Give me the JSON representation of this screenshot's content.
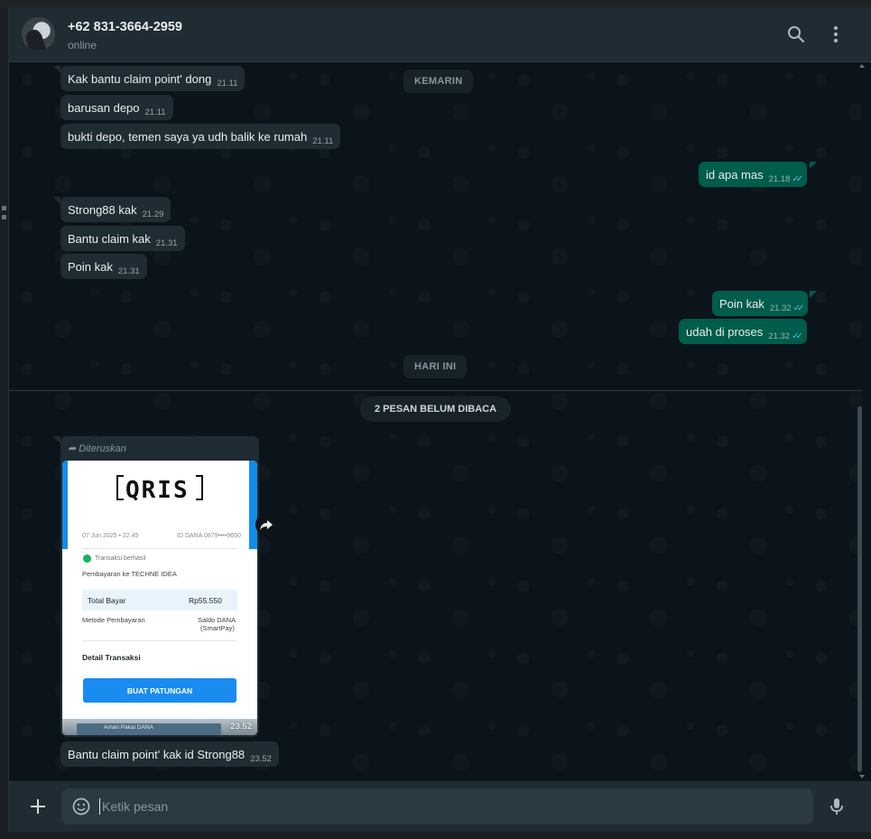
{
  "header": {
    "contact_name": "+62 831-3664-2959",
    "status": "online",
    "icons": [
      "search-icon",
      "menu-icon"
    ]
  },
  "dates": {
    "yesterday": "KEMARIN",
    "today": "HARI INI"
  },
  "unread": "2 PESAN BELUM DIBACA",
  "messages": [
    {
      "dir": "in",
      "text": "Kak bantu claim point' dong",
      "time": "21.11"
    },
    {
      "dir": "in",
      "text": "barusan depo",
      "time": "21.11"
    },
    {
      "dir": "in",
      "text": "bukti depo, temen saya ya udh balik ke rumah",
      "time": "21.11"
    },
    {
      "dir": "out",
      "text": "id apa mas",
      "time": "21.18",
      "ticks": "✓✓"
    },
    {
      "dir": "in",
      "text": "Strong88 kak",
      "time": "21.29"
    },
    {
      "dir": "in",
      "text": "Bantu claim kak",
      "time": "21.31"
    },
    {
      "dir": "in",
      "text": "Poin kak",
      "time": "21.31"
    },
    {
      "dir": "out",
      "text": "Poin kak",
      "time": "21.32",
      "ticks": "✓✓"
    },
    {
      "dir": "out",
      "text": "udah di proses",
      "time": "21.32",
      "ticks": "✓✓"
    },
    {
      "dir": "in",
      "text": "Bantu claim point' kak id Strong88",
      "time": "23.52"
    }
  ],
  "forwarded": {
    "label": "Diteruskan",
    "time": "23.52",
    "receipt": {
      "logo": "QRIS",
      "date": "07 Jun 2025 • 22.45",
      "id": "ID DANA 0879••••9650",
      "status": "Transaksi berhasil",
      "payee": "Pembayaran ke TECHNE IDEA",
      "total_label": "Total Bayar",
      "total_value": "Rp55.550",
      "method_label": "Metode Pembayaran",
      "method_value_1": "Saldo DANA",
      "method_value_2": "(SmartPay)",
      "detail_label": "Detail Transaksi",
      "button": "BUAT PATUNGAN",
      "footer": "Aman Pakai DANA"
    }
  },
  "composer": {
    "placeholder": "Ketik pesan",
    "icons": [
      "plus-icon",
      "emoji-icon",
      "mic-icon"
    ]
  },
  "colors": {
    "incoming": "#202c33",
    "outgoing": "#005c4b",
    "background": "#0b141a",
    "read_ticks": "#53bdeb"
  }
}
